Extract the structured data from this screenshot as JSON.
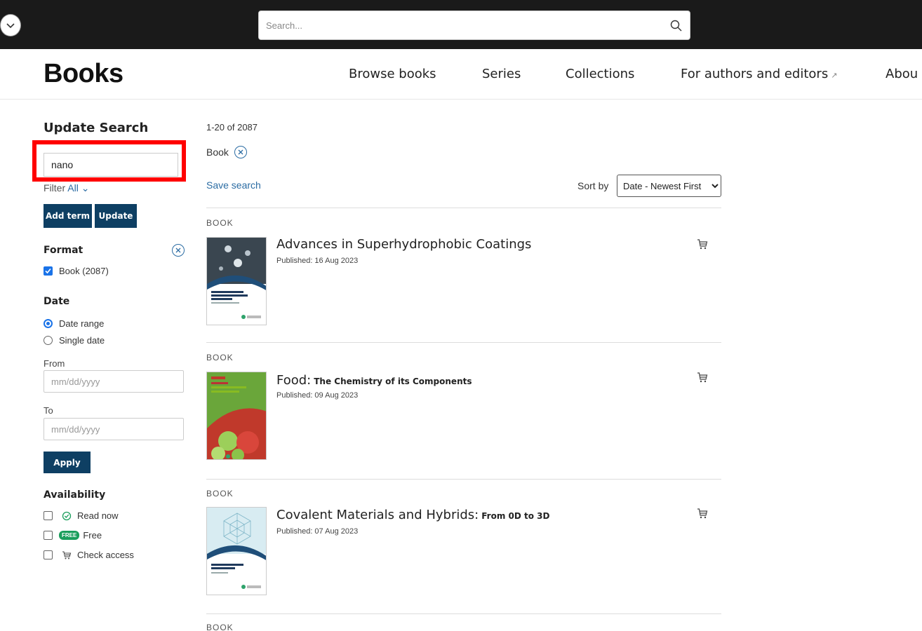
{
  "top": {
    "search_placeholder": "Search..."
  },
  "header": {
    "logo": "Books",
    "nav": [
      "Browse books",
      "Series",
      "Collections",
      "For authors and editors",
      "Abou"
    ]
  },
  "sidebar": {
    "title": "Update Search",
    "term_value": "nano",
    "filter_label": "Filter",
    "filter_value": "All",
    "add_term": "Add term",
    "update": "Update",
    "format_title": "Format",
    "format_option": "Book (2087)",
    "date_title": "Date",
    "date_range": "Date range",
    "single_date": "Single date",
    "from_label": "From",
    "to_label": "To",
    "date_placeholder": "mm/dd/yyyy",
    "apply": "Apply",
    "availability_title": "Availability",
    "read_now": "Read now",
    "free_badge": "FREE",
    "free": "Free",
    "check_access": "Check access"
  },
  "results": {
    "count": "1-20 of 2087",
    "chip": "Book",
    "save_search": "Save search",
    "sort_label": "Sort by",
    "sort_value": "Date - Newest First",
    "type_label": "BOOK",
    "books": [
      {
        "title": "Advances in Superhydrophobic Coatings",
        "subtitle": "",
        "date": "Published: 16 Aug 2023"
      },
      {
        "title": "Food:",
        "subtitle": "The Chemistry of its Components",
        "date": "Published: 09 Aug 2023"
      },
      {
        "title": "Covalent Materials and Hybrids:",
        "subtitle": "From 0D to 3D",
        "date": "Published: 07 Aug 2023"
      }
    ]
  },
  "colors": {
    "topbar": "#1a1a1a",
    "primary_button": "#0e3f63",
    "link": "#2b6ca3",
    "highlight": "#ff0000"
  }
}
